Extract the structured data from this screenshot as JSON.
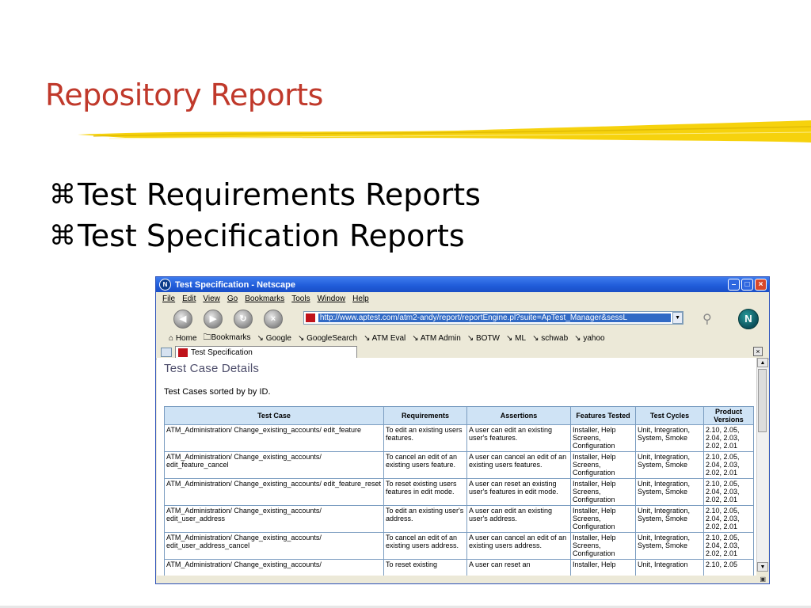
{
  "slide": {
    "title": "Repository Reports",
    "bullets": [
      "Test Requirements Reports",
      "Test Specification Reports"
    ],
    "bullet_glyph": "⌘",
    "title_color": "#c0392b",
    "brush_color": "#f5d000"
  },
  "browser": {
    "window_title": "Test Specification - Netscape",
    "menu": [
      "File",
      "Edit",
      "View",
      "Go",
      "Bookmarks",
      "Tools",
      "Window",
      "Help"
    ],
    "url": "http://www.aptest.com/atm2-andy/report/reportEngine.pl?suite=ApTest_Manager&sessL",
    "bookmarks": [
      "Home",
      "Bookmarks",
      "Google",
      "GoogleSearch",
      "ATM Eval",
      "ATM Admin",
      "BOTW",
      "ML",
      "schwab",
      "yahoo"
    ],
    "tab_label": "Test Specification",
    "logo_letter": "N"
  },
  "page": {
    "heading": "Test Case Details",
    "subheading": "Test Cases sorted by by ID.",
    "columns": [
      "Test Case",
      "Requirements",
      "Assertions",
      "Features Tested",
      "Test Cycles",
      "Product Versions"
    ],
    "rows": [
      [
        "ATM_Administration/ Change_existing_accounts/ edit_feature",
        "To edit an existing users features.",
        "A user can edit an existing user's features.",
        "Installer, Help Screens, Configuration",
        "Unit, Integration, System, Smoke",
        "2.10, 2.05, 2.04, 2.03, 2.02, 2.01"
      ],
      [
        "ATM_Administration/ Change_existing_accounts/ edit_feature_cancel",
        "To cancel an edit of an existing users feature.",
        "A user can cancel an edit of an existing users features.",
        "Installer, Help Screens, Configuration",
        "Unit, Integration, System, Smoke",
        "2.10, 2.05, 2.04, 2.03, 2.02, 2.01"
      ],
      [
        "ATM_Administration/ Change_existing_accounts/ edit_feature_reset",
        "To reset existing users features in edit mode.",
        "A user can reset an existing user's features in edit mode.",
        "Installer, Help Screens, Configuration",
        "Unit, Integration, System, Smoke",
        "2.10, 2.05, 2.04, 2.03, 2.02, 2.01"
      ],
      [
        "ATM_Administration/ Change_existing_accounts/ edit_user_address",
        "To edit an existing user's address.",
        "A user can edit an existing user's address.",
        "Installer, Help Screens, Configuration",
        "Unit, Integration, System, Smoke",
        "2.10, 2.05, 2.04, 2.03, 2.02, 2.01"
      ],
      [
        "ATM_Administration/ Change_existing_accounts/ edit_user_address_cancel",
        "To cancel an edit of an existing users address.",
        "A user can cancel an edit of an existing users address.",
        "Installer, Help Screens, Configuration",
        "Unit, Integration, System, Smoke",
        "2.10, 2.05, 2.04, 2.03, 2.02, 2.01"
      ],
      [
        "ATM_Administration/ Change_existing_accounts/",
        "To reset existing",
        "A user can reset an",
        "Installer, Help",
        "Unit, Integration",
        "2.10, 2.05"
      ]
    ]
  }
}
